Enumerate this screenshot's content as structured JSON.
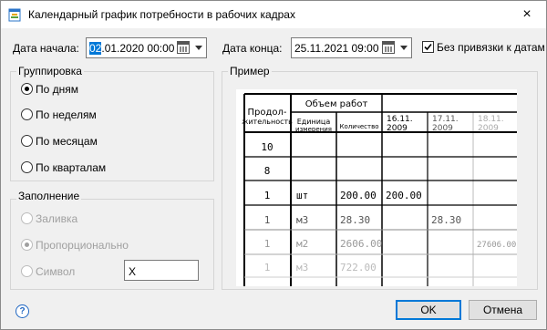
{
  "window": {
    "title": "Календарный график потребности в рабочих кадрах",
    "close_icon": "×"
  },
  "dates": {
    "start_label": "Дата начала:",
    "start_value_selected": "02",
    "start_value_rest": ".01.2020 00:00",
    "end_label": "Дата конца:",
    "end_value": "25.11.2021 09:00",
    "no_binding_label": "Без привязки к датам",
    "no_binding_checked": true
  },
  "grouping": {
    "title": "Группировка",
    "options": [
      "По дням",
      "По неделям",
      "По месяцам",
      "По кварталам"
    ],
    "selected": "По дням"
  },
  "fill": {
    "title": "Заполнение",
    "options": [
      "Заливка",
      "Пропорционально",
      "Символ"
    ],
    "selected": "Пропорционально",
    "symbol_value": "X"
  },
  "example": {
    "title": "Пример",
    "header_duration_1": "Продол-",
    "header_duration_2": "жительность",
    "header_volume": "Объем работ",
    "header_unit_1": "Единица",
    "header_unit_2": "измерения",
    "header_qty": "Количество",
    "dates": [
      {
        "day": "16.11.",
        "year": "2009"
      },
      {
        "day": "17.11.",
        "year": "2009"
      },
      {
        "day": "18.11.",
        "year": "2009"
      }
    ],
    "rows": [
      {
        "duration": "10",
        "unit": "",
        "qty": "",
        "d1": "",
        "d2": "",
        "d3": ""
      },
      {
        "duration": "8",
        "unit": "",
        "qty": "",
        "d1": "",
        "d2": "",
        "d3": ""
      },
      {
        "duration": "1",
        "unit": "шт",
        "qty": "200.00",
        "d1": "200.00",
        "d2": "",
        "d3": ""
      },
      {
        "duration": "1",
        "unit": "м3",
        "qty": "28.30",
        "d1": "",
        "d2": "28.30",
        "d3": ""
      },
      {
        "duration": "1",
        "unit": "м2",
        "qty": "2606.00",
        "d1": "",
        "d2": "",
        "d3": "27606.00"
      },
      {
        "duration": "1",
        "unit": "м3",
        "qty": "722.00",
        "d1": "",
        "d2": "",
        "d3": ""
      }
    ]
  },
  "buttons": {
    "ok": "OK",
    "cancel": "Отмена",
    "help": "?"
  }
}
